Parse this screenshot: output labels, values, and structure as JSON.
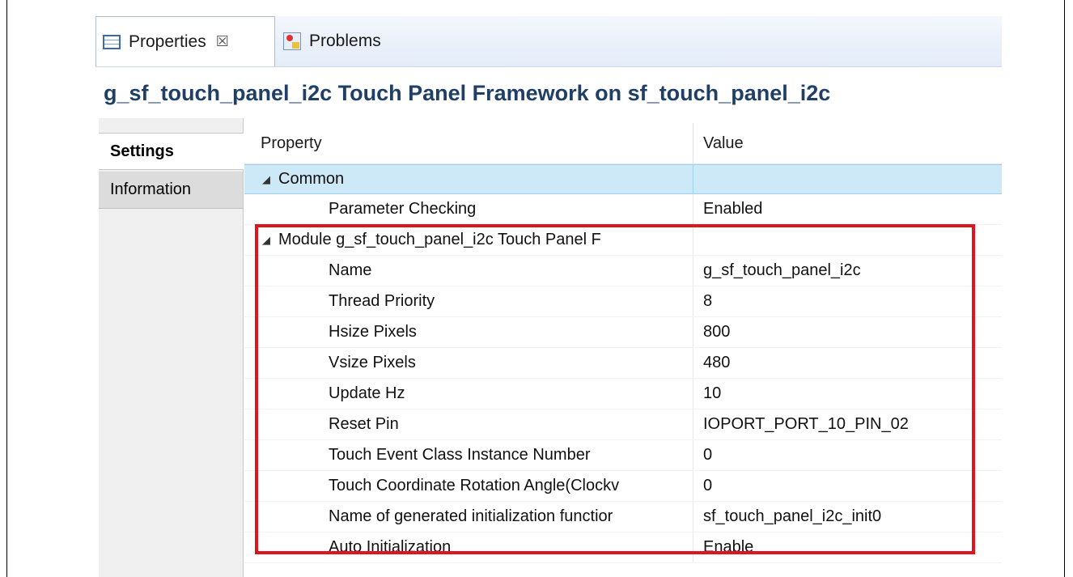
{
  "tabs": [
    {
      "label": "Properties",
      "icon": "properties-icon",
      "active": true,
      "close_glyph": "☒"
    },
    {
      "label": "Problems",
      "icon": "problems-icon",
      "active": false
    }
  ],
  "title": "g_sf_touch_panel_i2c Touch Panel Framework on sf_touch_panel_i2c",
  "sidebar": {
    "items": [
      {
        "label": "Settings",
        "selected": true
      },
      {
        "label": "Information",
        "selected": false
      }
    ]
  },
  "table": {
    "headers": {
      "property": "Property",
      "value": "Value"
    },
    "rows": [
      {
        "type": "category",
        "expanded": true,
        "property": "Common",
        "value": ""
      },
      {
        "type": "property",
        "property": "Parameter Checking",
        "value": "Enabled"
      },
      {
        "type": "category",
        "expanded": true,
        "property": "Module g_sf_touch_panel_i2c Touch Panel F",
        "value": ""
      },
      {
        "type": "property",
        "property": "Name",
        "value": "g_sf_touch_panel_i2c"
      },
      {
        "type": "property",
        "property": "Thread Priority",
        "value": "8"
      },
      {
        "type": "property",
        "property": "Hsize Pixels",
        "value": "800"
      },
      {
        "type": "property",
        "property": "Vsize Pixels",
        "value": "480"
      },
      {
        "type": "property",
        "property": "Update Hz",
        "value": "10"
      },
      {
        "type": "property",
        "property": "Reset Pin",
        "value": "IOPORT_PORT_10_PIN_02"
      },
      {
        "type": "property",
        "property": "Touch Event Class Instance Number",
        "value": "0"
      },
      {
        "type": "property",
        "property": "Touch Coordinate Rotation Angle(Clockv",
        "value": "0"
      },
      {
        "type": "property",
        "property": "Name of generated initialization functior",
        "value": "sf_touch_panel_i2c_init0"
      },
      {
        "type": "property",
        "property": "Auto Initialization",
        "value": "Enable"
      }
    ]
  },
  "colors": {
    "highlight_box": "#e0141e",
    "title": "#1f3f66",
    "selected_row": "#cde8f6"
  },
  "expand_glyph": "◢"
}
